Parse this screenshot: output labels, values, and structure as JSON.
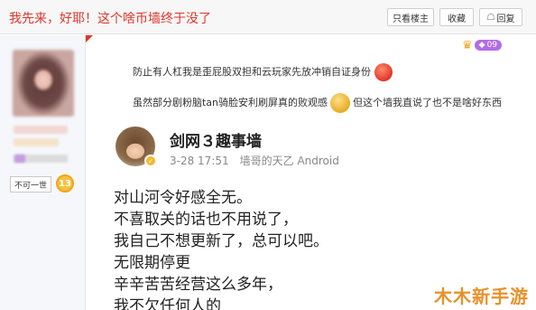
{
  "header": {
    "title": "我先来，好耶！这个啥币墙终于没了",
    "only_author_label": "只看楼主",
    "collect_label": "收藏",
    "reply_label": "回复"
  },
  "user": {
    "tag_label": "不可一世",
    "level": "13"
  },
  "post": {
    "vip_label": "09",
    "line1": "防止有人杠我是歪屁股双担和云玩家先放冲销自证身份",
    "line2_a": "虽然部分剧粉脑tan骑脸安利刷屏真的败观感",
    "line2_b": "但这个墙我直说了也不是啥好东西"
  },
  "screenshot": {
    "account_name": "剑网３趣事墙",
    "time": "3-28 17:51",
    "source": "墙哥的天乙 Android",
    "lines": [
      "对山河令好感全无。",
      "不喜取关的话也不用说了，",
      "我自己不想更新了，总可以吧。",
      "无限期停更",
      "辛辛苦苦经营这么多年，",
      "我不欠任何人的"
    ]
  },
  "watermark": "木木新手游",
  "colors": {
    "title_red": "#e0352b",
    "vip_purple": "#b26de6",
    "watermark_orange": "#e8912a"
  }
}
